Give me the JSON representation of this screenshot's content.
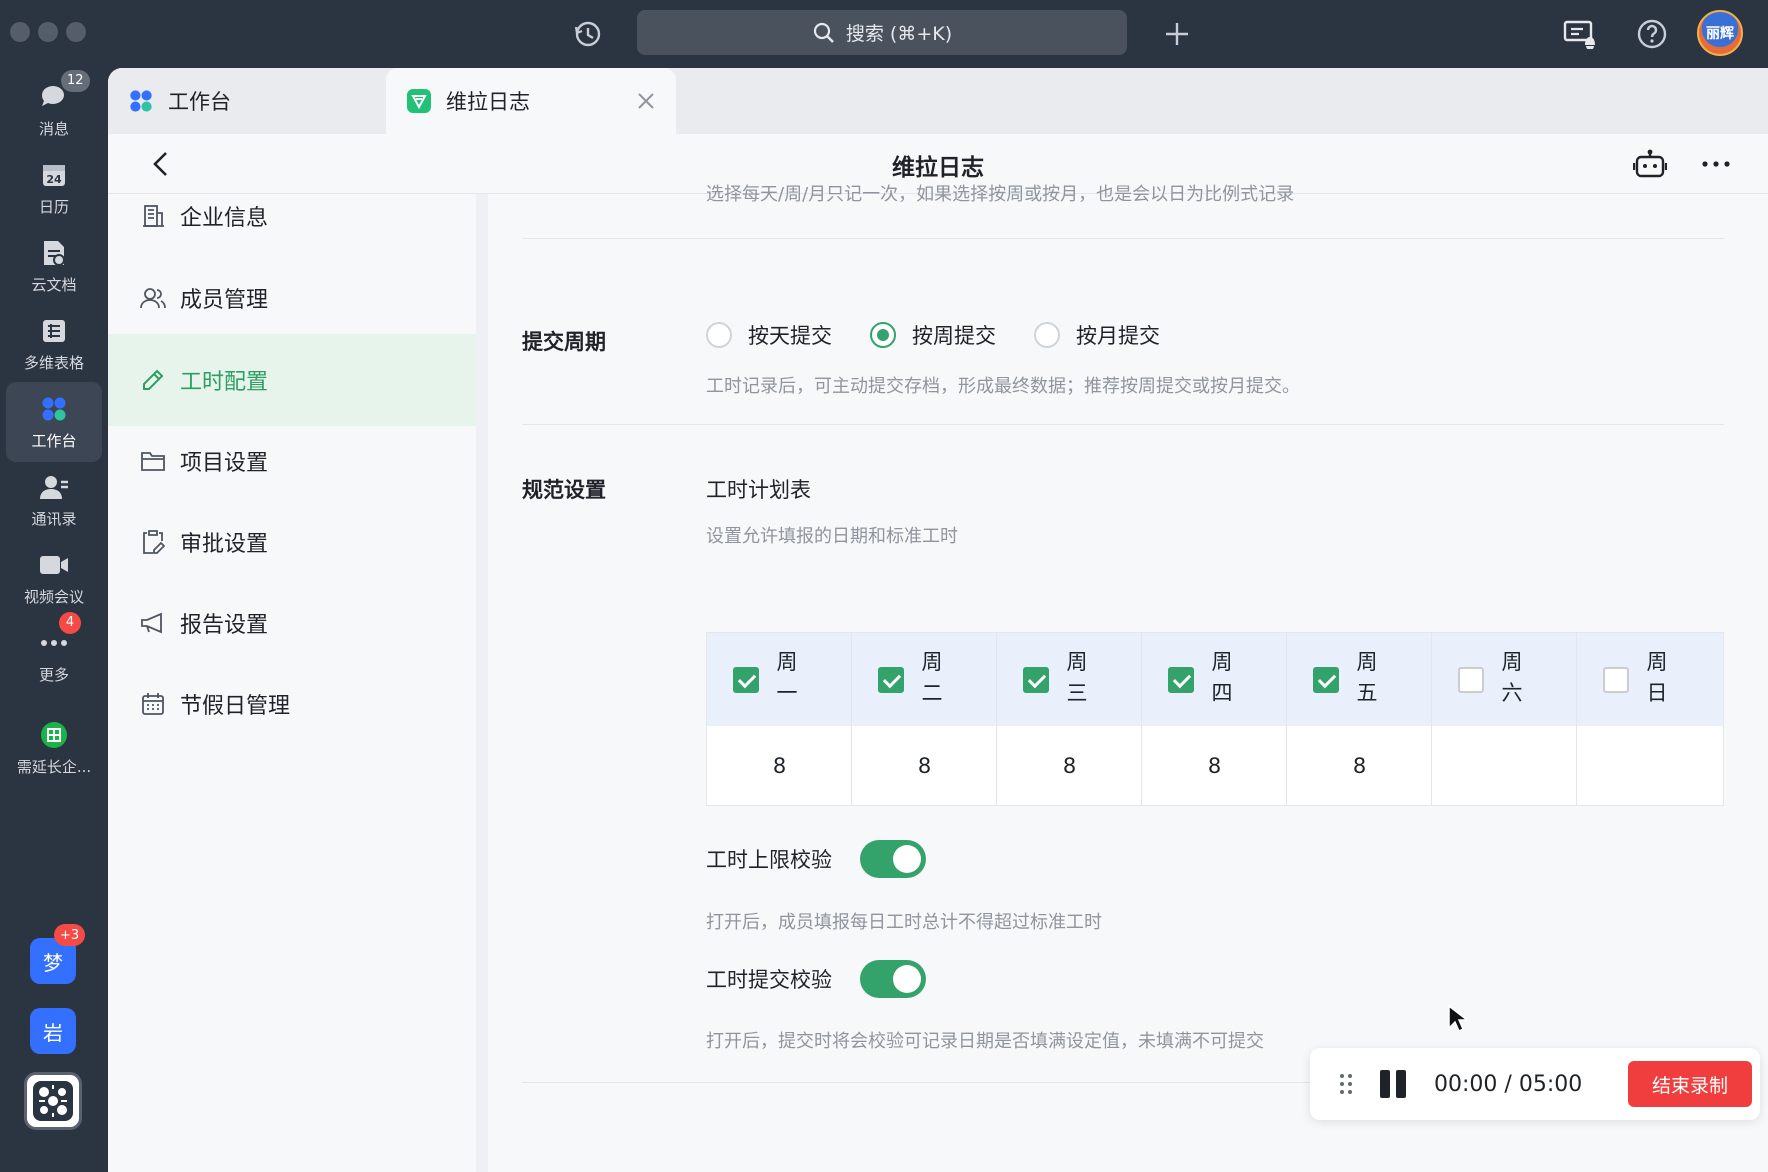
{
  "titlebar": {
    "search_placeholder": "搜索 (⌘+K)",
    "avatar_text": "丽辉"
  },
  "rail": {
    "items": [
      {
        "label": "消息",
        "badge": "12",
        "icon": "message-icon"
      },
      {
        "label": "日历",
        "icon": "calendar-icon",
        "day": "24"
      },
      {
        "label": "云文档",
        "icon": "document-icon"
      },
      {
        "label": "多维表格",
        "icon": "table-icon"
      },
      {
        "label": "工作台",
        "icon": "workbench-icon",
        "active": true
      },
      {
        "label": "通讯录",
        "icon": "contacts-icon"
      },
      {
        "label": "视频会议",
        "icon": "video-icon"
      },
      {
        "label": "更多",
        "badge": "4",
        "icon": "more-icon"
      },
      {
        "label": "需延长企...",
        "icon": "grid-app-icon"
      }
    ],
    "pinned": [
      {
        "text": "梦",
        "badge": "+3"
      },
      {
        "text": "岩"
      }
    ]
  },
  "tabs": [
    {
      "label": "工作台",
      "icon": "workbench-icon"
    },
    {
      "label": "维拉日志",
      "icon": "app-logo-icon",
      "active": true
    }
  ],
  "header": {
    "title": "维拉日志"
  },
  "settings_nav": [
    {
      "label": "企业信息",
      "icon": "building-icon"
    },
    {
      "label": "成员管理",
      "icon": "members-icon"
    },
    {
      "label": "工时配置",
      "icon": "pencil-icon",
      "active": true
    },
    {
      "label": "项目设置",
      "icon": "folder-icon"
    },
    {
      "label": "审批设置",
      "icon": "approval-icon"
    },
    {
      "label": "报告设置",
      "icon": "megaphone-icon"
    },
    {
      "label": "节假日管理",
      "icon": "calendar-icon"
    }
  ],
  "content": {
    "clipped_top_text": "选择每天/周/月只记一次，如果选择按周或按月，也是会以日为比例式记录",
    "submit_period": {
      "label": "提交周期",
      "options": [
        {
          "label": "按天提交",
          "selected": false
        },
        {
          "label": "按周提交",
          "selected": true
        },
        {
          "label": "按月提交",
          "selected": false
        }
      ],
      "hint": "工时记录后，可主动提交存档，形成最终数据；推荐按周提交或按月提交。"
    },
    "norms": {
      "label": "规范设置",
      "schedule_title": "工时计划表",
      "schedule_hint": "设置允许填报的日期和标准工时",
      "days": [
        {
          "line1": "周",
          "line2": "一",
          "checked": true,
          "hours": "8"
        },
        {
          "line1": "周",
          "line2": "二",
          "checked": true,
          "hours": "8"
        },
        {
          "line1": "周",
          "line2": "三",
          "checked": true,
          "hours": "8"
        },
        {
          "line1": "周",
          "line2": "四",
          "checked": true,
          "hours": "8"
        },
        {
          "line1": "周",
          "line2": "五",
          "checked": true,
          "hours": "8"
        },
        {
          "line1": "周",
          "line2": "六",
          "checked": false,
          "hours": ""
        },
        {
          "line1": "周",
          "line2": "日",
          "checked": false,
          "hours": ""
        }
      ],
      "upper_limit": {
        "label": "工时上限校验",
        "enabled": true,
        "hint": "打开后，成员填报每日工时总计不得超过标准工时"
      },
      "submit_check": {
        "label": "工时提交校验",
        "enabled": true,
        "hint": "打开后，提交时将会校验可记录日期是否填满设定值，未填满不可提交"
      }
    }
  },
  "recorder": {
    "elapsed": "00:00",
    "separator": "/",
    "total": "05:00",
    "stop_label": "结束录制"
  },
  "colors": {
    "accent": "#34a36b",
    "rail_bg": "#2b3441",
    "stop_red": "#f03e3e"
  }
}
